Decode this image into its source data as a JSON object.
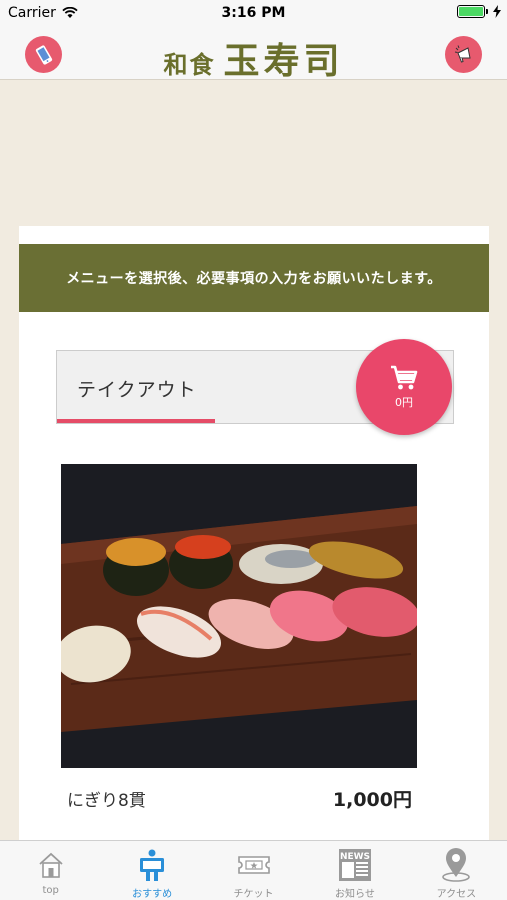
{
  "status_bar": {
    "carrier": "Carrier",
    "time": "3:16 PM"
  },
  "header": {
    "logo_small": "和食",
    "logo_big": "玉寿司",
    "left_icon": "phone-icon",
    "right_icon": "megaphone-icon",
    "accent_color": "#e75a6e"
  },
  "banner": {
    "text": "メニューを選択後、必要事項の入力をお願いいたします。",
    "color": "#6a6f34"
  },
  "order_tab": {
    "label": "テイクアウト"
  },
  "cart": {
    "total": "0円",
    "icon": "cart-icon",
    "color": "#e9476a"
  },
  "menu_item": {
    "name": "にぎり8貫",
    "price": "1,000円"
  },
  "tab_bar": {
    "items": [
      {
        "label": "top",
        "icon": "home-icon"
      },
      {
        "label": "おすすめ",
        "icon": "signboard-person-icon",
        "active": true
      },
      {
        "label": "チケット",
        "icon": "ticket-icon"
      },
      {
        "label": "お知らせ",
        "icon": "news-icon",
        "badge": "NEWS"
      },
      {
        "label": "アクセス",
        "icon": "map-pin-icon"
      }
    ],
    "active_color": "#2a8fd8"
  }
}
